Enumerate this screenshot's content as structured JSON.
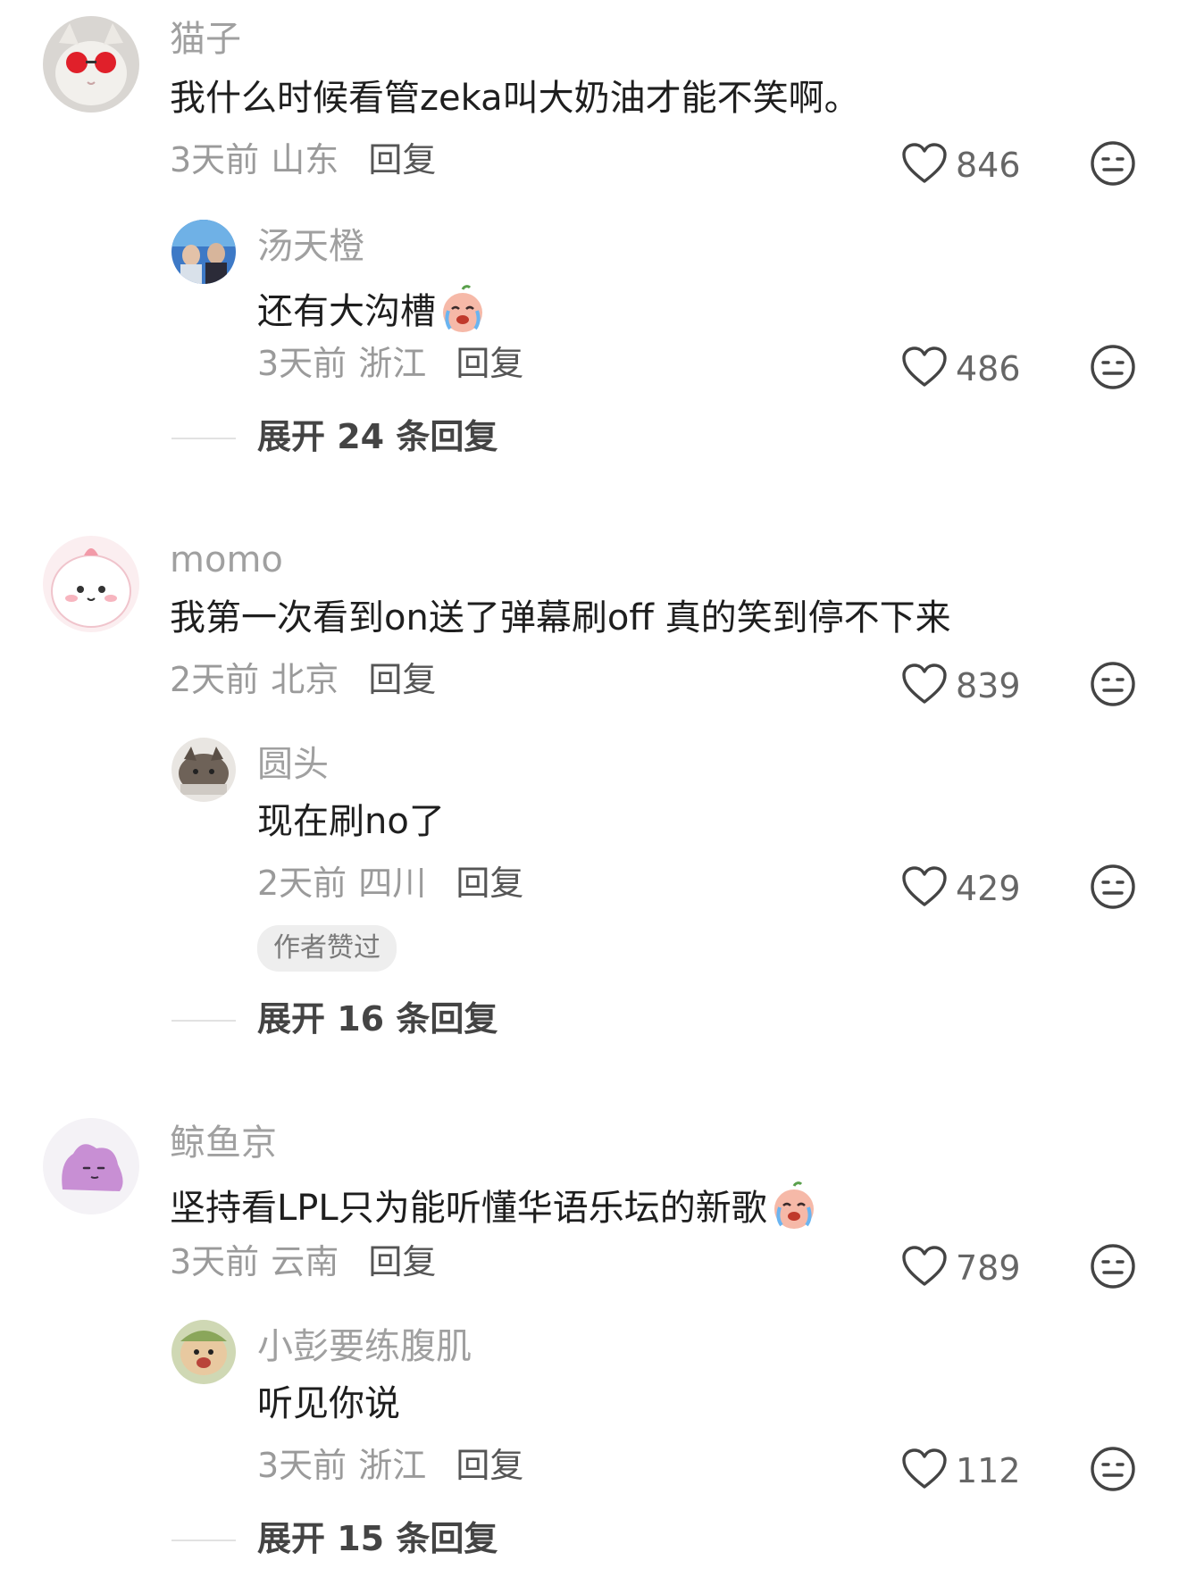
{
  "comments": [
    {
      "name": "猫子",
      "text": "我什么时候看管zeka叫大奶油才能不笑啊。",
      "time": "3天前",
      "location": "山东",
      "reply_label": "回复",
      "likes": "846",
      "reply": {
        "name": "汤天橙",
        "text": "还有大沟槽",
        "emoji": "crying-face-sticker",
        "time": "3天前",
        "location": "浙江",
        "reply_label": "回复",
        "likes": "486"
      },
      "expand_label": "展开 24 条回复"
    },
    {
      "name": "momo",
      "text": "我第一次看到on送了弹幕刷off 真的笑到停不下来",
      "time": "2天前",
      "location": "北京",
      "reply_label": "回复",
      "likes": "839",
      "reply": {
        "name": "圆头",
        "text": "现在刷no了",
        "time": "2天前",
        "location": "四川",
        "reply_label": "回复",
        "likes": "429",
        "badge": "作者赞过"
      },
      "expand_label": "展开 16 条回复"
    },
    {
      "name": "鲸鱼京",
      "text": "坚持看LPL只为能听懂华语乐坛的新歌",
      "emoji": "crying-face-sticker",
      "time": "3天前",
      "location": "云南",
      "reply_label": "回复",
      "likes": "789",
      "reply": {
        "name": "小彭要练腹肌",
        "text": "听见你说",
        "time": "3天前",
        "location": "浙江",
        "reply_label": "回复",
        "likes": "112"
      },
      "expand_label": "展开 15 条回复"
    }
  ],
  "icons": {
    "like": "heart-outline-icon",
    "dislike": "meh-face-icon"
  },
  "colors": {
    "username": "#a0a0a0",
    "body_text": "#1e1e1e",
    "meta_text": "#9a9a9a",
    "badge_bg": "#eeeeee"
  }
}
